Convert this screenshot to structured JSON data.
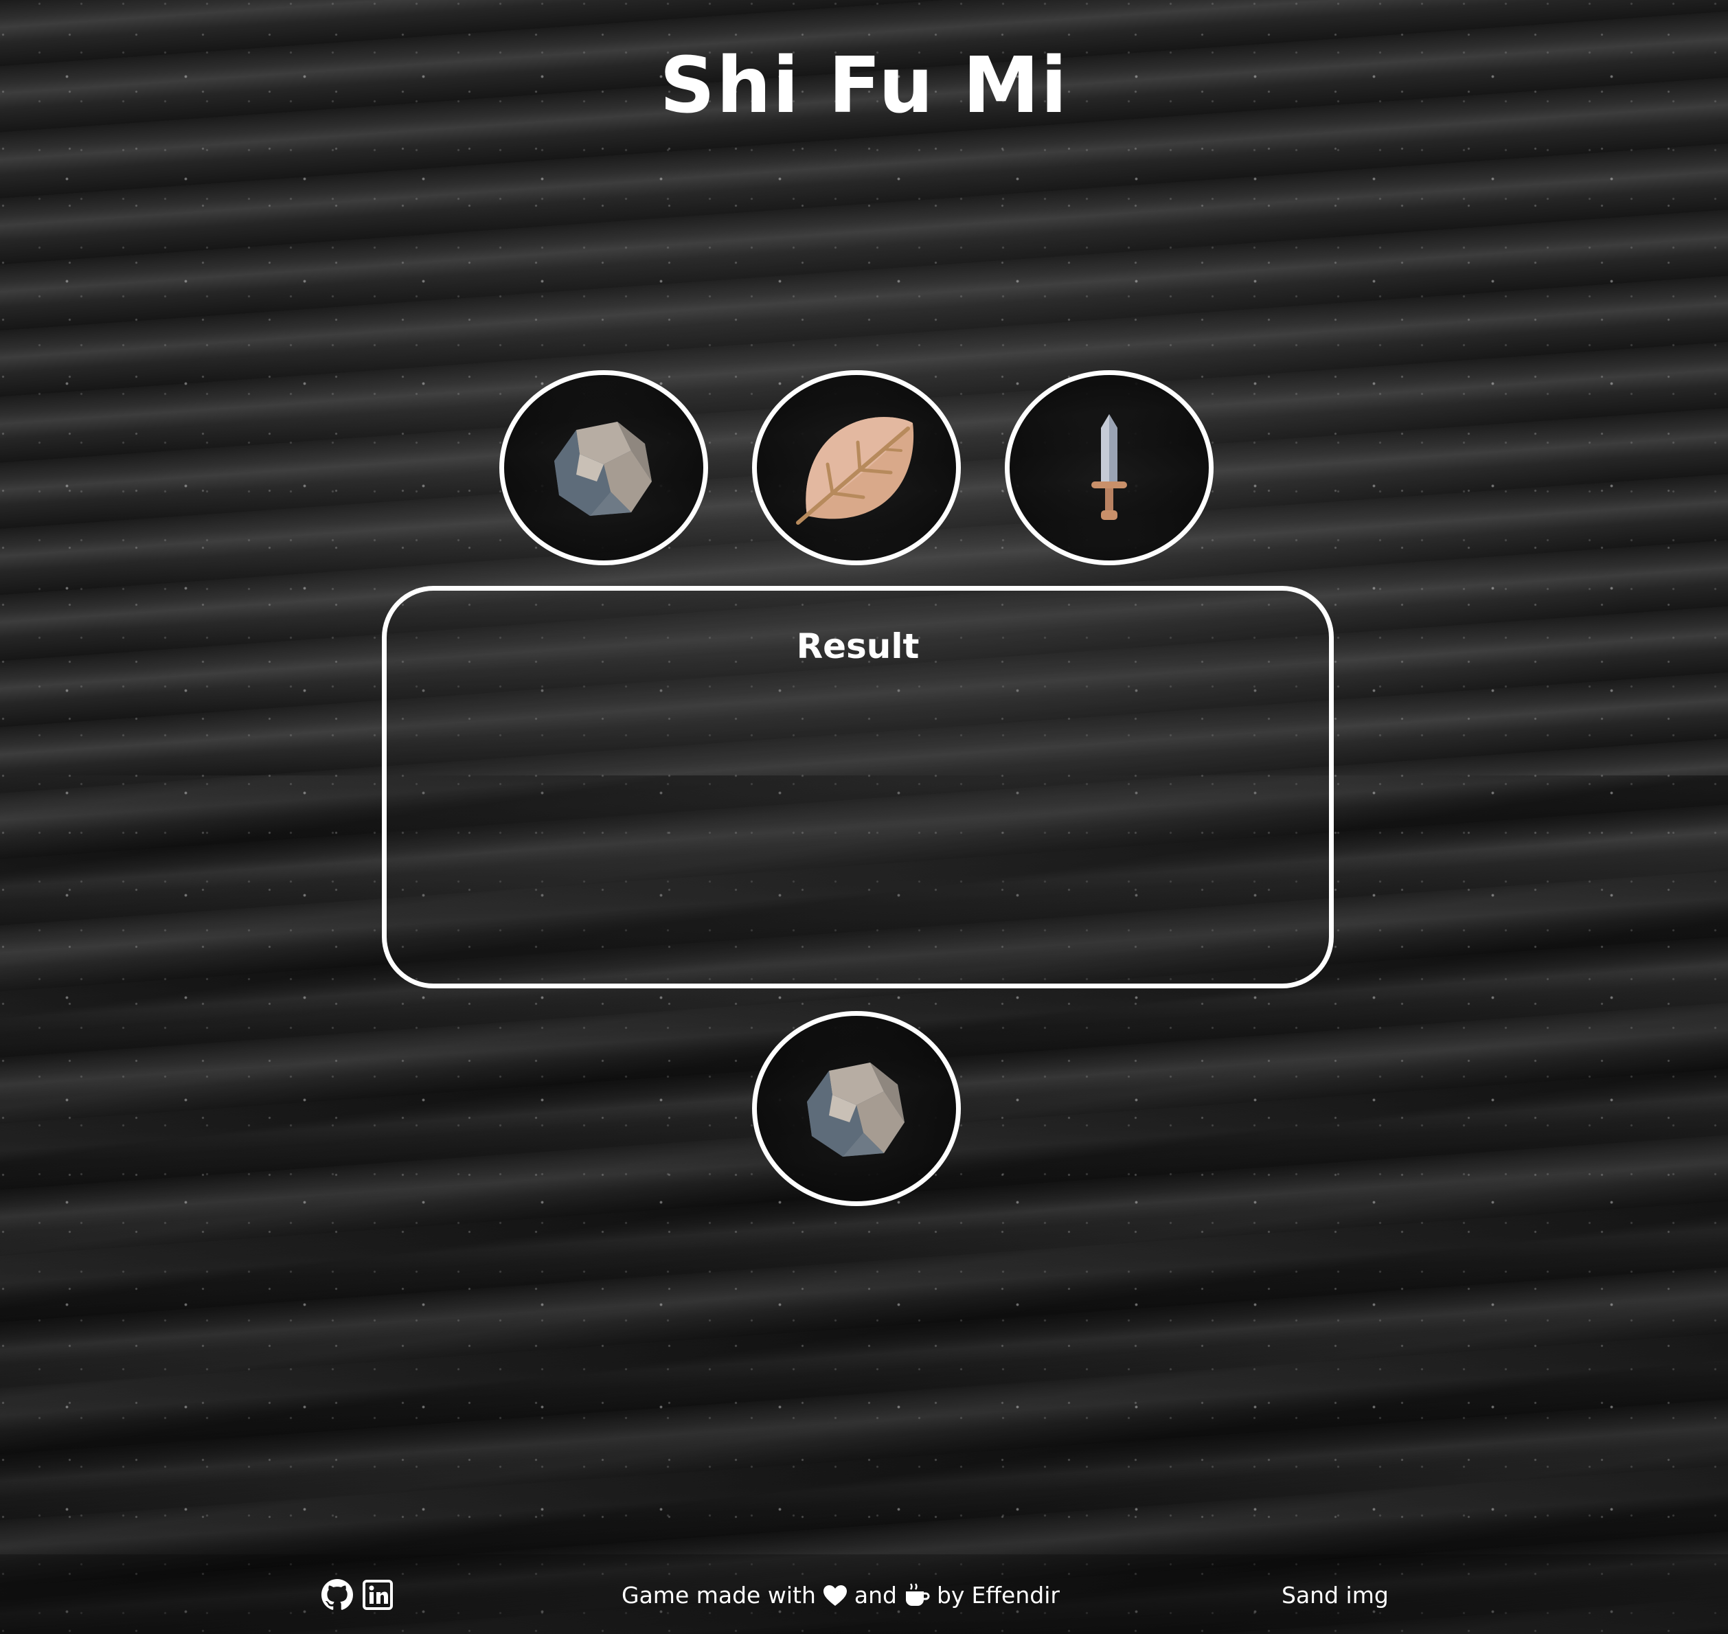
{
  "game": {
    "title": "Shi Fu Mi"
  },
  "choices": [
    {
      "name": "rock",
      "icon": "rock-icon"
    },
    {
      "name": "leaf",
      "icon": "leaf-icon"
    },
    {
      "name": "sword",
      "icon": "sword-icon"
    }
  ],
  "result": {
    "title": "Result"
  },
  "computer_choice": {
    "icon": "rock-icon"
  },
  "footer": {
    "links": [
      {
        "icon": "github-icon"
      },
      {
        "icon": "linkedin-icon"
      }
    ],
    "credit_prefix": "Game made with",
    "credit_and": "and",
    "credit_by": "by",
    "author": "Effendir",
    "image_credit": "Sand img"
  },
  "colors": {
    "border": "#ffffff",
    "text": "#ffffff",
    "background": "#232323"
  }
}
